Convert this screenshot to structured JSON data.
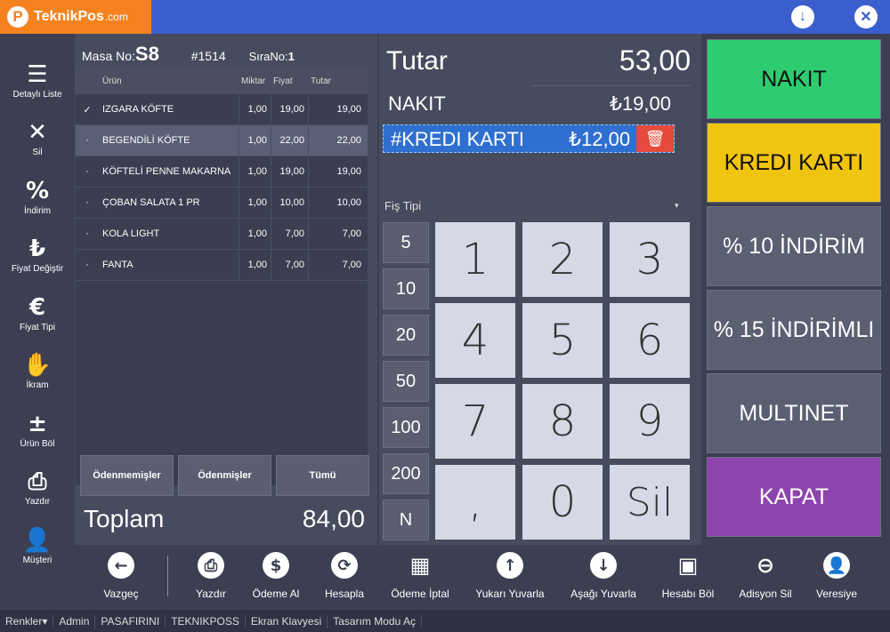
{
  "titlebar": {
    "brand": "TeknikPos",
    "domain": ".com",
    "logo_letter": "P",
    "down_icon": "arrow-down-circle-icon",
    "close_icon": "close-circle-icon"
  },
  "sidebar": {
    "items": [
      {
        "label": "Detaylı Liste",
        "icon": "list-detail-icon",
        "glyph": "☰"
      },
      {
        "label": "Sil",
        "icon": "delete-x-icon",
        "glyph": "✕"
      },
      {
        "label": "İndirim",
        "icon": "percent-icon",
        "glyph": "%"
      },
      {
        "label": "Fiyat Değiştir",
        "icon": "price-change-icon",
        "glyph": "₺"
      },
      {
        "label": "Fiyat Tipi",
        "icon": "price-type-icon",
        "glyph": "€"
      },
      {
        "label": "İkram",
        "icon": "treat-icon",
        "glyph": "✋"
      },
      {
        "label": "Ürün Böl",
        "icon": "split-item-icon",
        "glyph": "±"
      },
      {
        "label": "Yazdır",
        "icon": "printer-icon",
        "glyph": "⎙"
      },
      {
        "label": "Müşteri",
        "icon": "customer-icon",
        "glyph": "👤"
      }
    ]
  },
  "order": {
    "masa_label": "Masa No:",
    "masa_value": "S8",
    "ticket": "#1514",
    "sira_label": "SıraNo:",
    "sira_value": "1",
    "headers": [
      "Ürün",
      "Miktar",
      "Fiyat",
      "Tutar"
    ],
    "rows": [
      {
        "mark": "✓",
        "name": "IZGARA KÖFTE",
        "qty": "1,00",
        "price": "19,00",
        "total": "19,00"
      },
      {
        "mark": "·",
        "name": "BEGENDİLİ KÖFTE",
        "qty": "1,00",
        "price": "22,00",
        "total": "22,00"
      },
      {
        "mark": "·",
        "name": "KÖFTELİ PENNE MAKARNA",
        "qty": "1,00",
        "price": "19,00",
        "total": "19,00"
      },
      {
        "mark": "·",
        "name": "ÇOBAN SALATA 1 PR",
        "qty": "1,00",
        "price": "10,00",
        "total": "10,00"
      },
      {
        "mark": "·",
        "name": "KOLA LIGHT",
        "qty": "1,00",
        "price": "7,00",
        "total": "7,00"
      },
      {
        "mark": "·",
        "name": "FANTA",
        "qty": "1,00",
        "price": "7,00",
        "total": "7,00"
      }
    ],
    "filters": [
      "Ödenmemişler",
      "Ödenmişler",
      "Tümü"
    ],
    "toplam_label": "Toplam",
    "toplam_value": "84,00"
  },
  "payment": {
    "tutar_label": "Tutar",
    "tutar_value": "53,00",
    "nakit_label": "NAKIT",
    "nakit_value": "₺19,00",
    "kredi_label": "#KREDI KARTI",
    "kredi_value": "₺12,00",
    "fis_label": "Fiş Tipi",
    "quick": [
      "5",
      "10",
      "20",
      "50",
      "100",
      "200",
      "N"
    ],
    "keys": [
      "1",
      "2",
      "3",
      "4",
      "5",
      "6",
      "7",
      "8",
      "9",
      ",",
      "0",
      "Sil"
    ]
  },
  "methods": [
    {
      "label": "NAKIT",
      "bg": "#2ecc71",
      "fg": "#111111"
    },
    {
      "label": "KREDI KARTI",
      "bg": "#f1c40f",
      "fg": "#111111"
    },
    {
      "label": "% 10 İNDİRİM",
      "bg": "#5b5f72",
      "fg": "#ffffff"
    },
    {
      "label": "% 15 İNDİRİMLI",
      "bg": "#5b5f72",
      "fg": "#ffffff"
    },
    {
      "label": "MULTINET",
      "bg": "#5b5f72",
      "fg": "#ffffff"
    },
    {
      "label": "KAPAT",
      "bg": "#8e44ad",
      "fg": "#ffffff"
    }
  ],
  "bottom": [
    {
      "label": "Vazgeç",
      "icon": "back-arrow-icon",
      "glyph": "←"
    },
    {
      "label": "Yazdır",
      "icon": "printer-icon",
      "glyph": "⎙"
    },
    {
      "label": "Ödeme Al",
      "icon": "take-payment-icon",
      "glyph": "$"
    },
    {
      "label": "Hesapla",
      "icon": "refresh-icon",
      "glyph": "⟳"
    },
    {
      "label": "Ödeme İptal",
      "icon": "cancel-payment-icon",
      "glyph": "▦"
    },
    {
      "label": "Yukarı Yuvarla",
      "icon": "round-up-icon",
      "glyph": "↑"
    },
    {
      "label": "Aşağı Yuvarla",
      "icon": "round-down-icon",
      "glyph": "↓"
    },
    {
      "label": "Hesabı Böl",
      "icon": "split-bill-icon",
      "glyph": "▣"
    },
    {
      "label": "Adisyon Sil",
      "icon": "delete-bill-icon",
      "glyph": "⊖"
    },
    {
      "label": "Veresiye",
      "icon": "credit-customer-icon",
      "glyph": "👤"
    }
  ],
  "status": [
    "Renkler▾",
    "Admin",
    "PASAFIRINI",
    "TEKNIKPOSS",
    "Ekran Klavyesi",
    "Tasarım Modu Aç"
  ]
}
